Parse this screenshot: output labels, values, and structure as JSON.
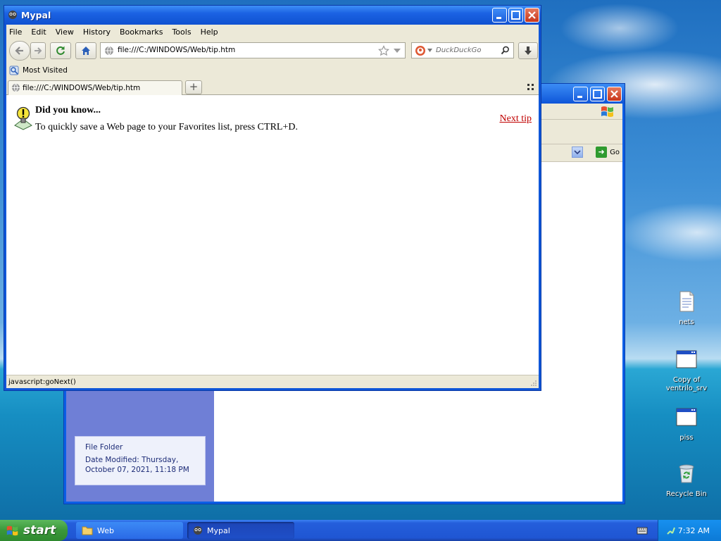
{
  "desktop": {
    "icons": [
      {
        "label": "nets"
      },
      {
        "label": "Copy of ventrilo_srv"
      },
      {
        "label": "piss"
      },
      {
        "label": "Recycle Bin"
      }
    ]
  },
  "background_window": {
    "go_label": "Go",
    "details": {
      "type": "File Folder",
      "date_modified": "Date Modified: Thursday, October 07, 2021, 11:18 PM"
    }
  },
  "browser": {
    "title": "Mypal",
    "menu": [
      "File",
      "Edit",
      "View",
      "History",
      "Bookmarks",
      "Tools",
      "Help"
    ],
    "url": "file:///C:/WINDOWS/Web/tip.htm",
    "search_placeholder": "DuckDuckGo",
    "bookmarks": {
      "most_visited": "Most Visited"
    },
    "tab": {
      "label": "file:///C:/WINDOWS/Web/tip.htm"
    },
    "content": {
      "heading": "Did you know...",
      "tip": "To quickly save a Web page to your Favorites list, press CTRL+D.",
      "next_tip": "Next tip"
    },
    "status": "javascript:goNext()"
  },
  "taskbar": {
    "start": "start",
    "buttons": [
      {
        "label": "Web"
      },
      {
        "label": "Mypal"
      }
    ],
    "clock": "7:32 AM"
  },
  "colors": {
    "xp_blue": "#0f56d8",
    "link_red": "#c00000",
    "start_green": "#3a973a"
  }
}
